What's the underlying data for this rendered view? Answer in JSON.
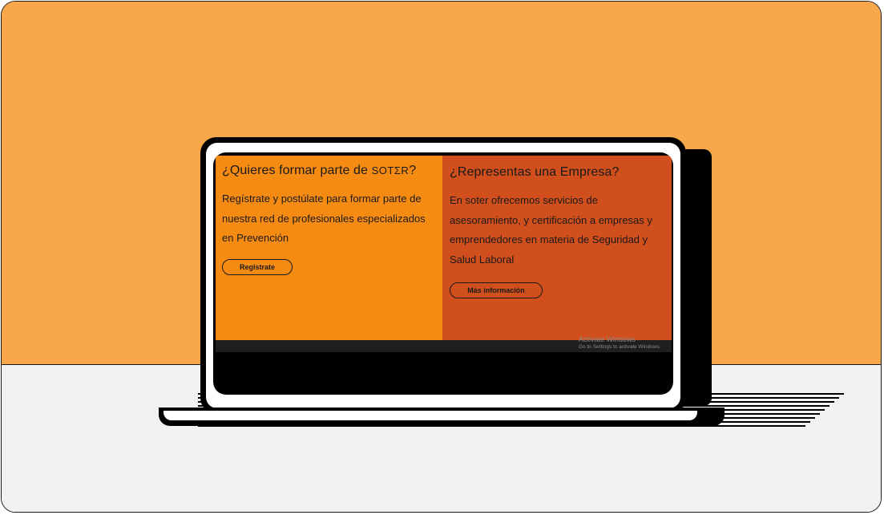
{
  "left_panel": {
    "title": "¿Quieres formar parte de",
    "brand": "SOTΣR",
    "title_suffix": "?",
    "text": "Regístrate y postúlate para formar parte de nuestra red de profesionales especializados en Prevención",
    "button_label": "Registrate"
  },
  "right_panel": {
    "title": "¿Representas una Empresa?",
    "text": "En soter ofrecemos servicios de asesoramiento, y certificación a empresas y emprendedores en materia de Seguridad y Salud Laboral",
    "button_label": "Más información"
  },
  "watermark": {
    "line1": "Activate Windows",
    "line2": "Go to Settings to activate Windows."
  },
  "colors": {
    "background_top": "#f8a74b",
    "background_bottom": "#f2f2f2",
    "left_panel": "#f68b13",
    "right_panel": "#d04f1c"
  }
}
